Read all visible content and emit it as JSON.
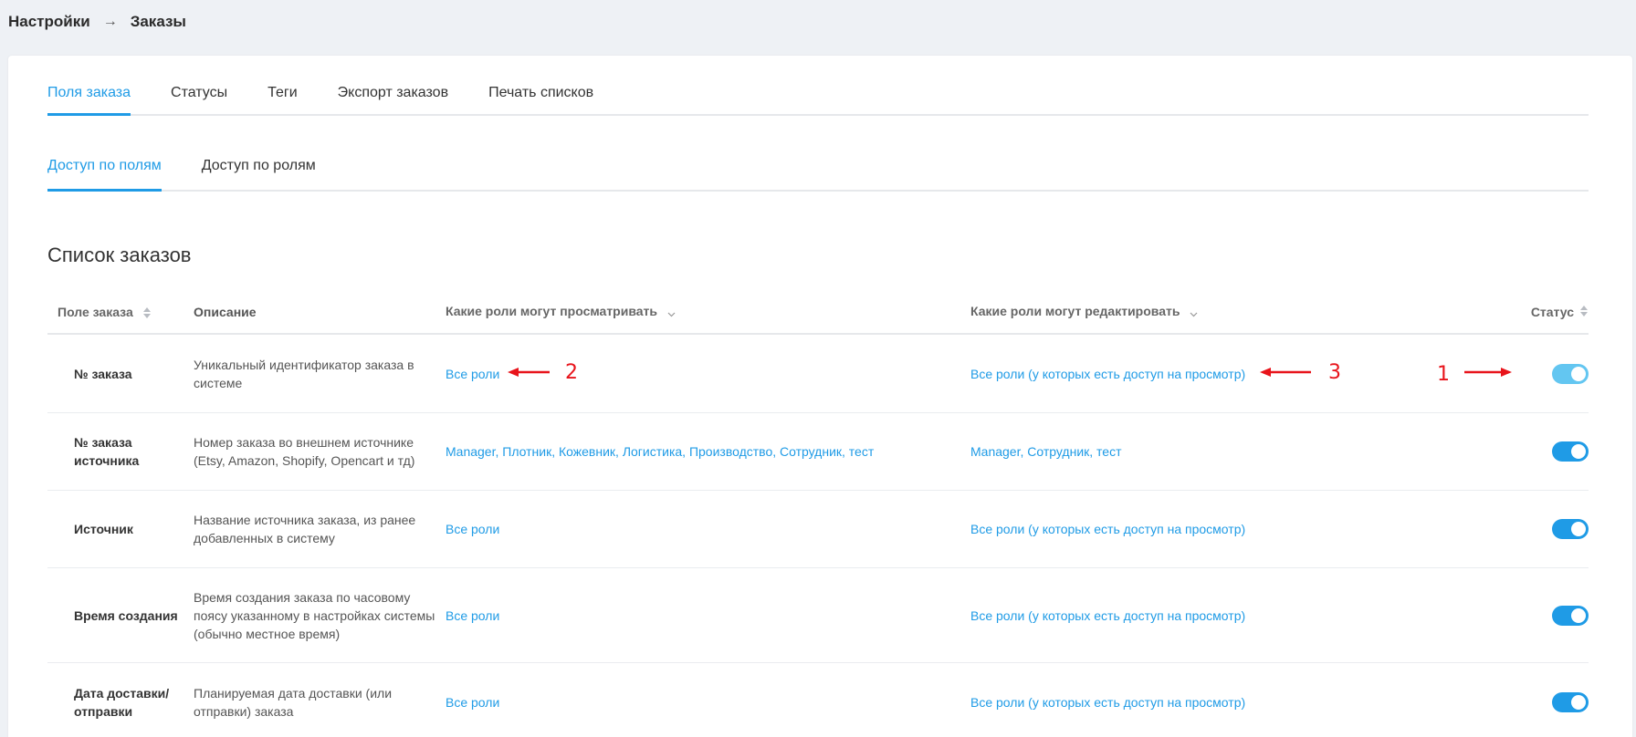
{
  "breadcrumb": {
    "items": [
      "Настройки",
      "Заказы"
    ],
    "separator": "→"
  },
  "tabs": [
    {
      "label": "Поля заказа",
      "active": true
    },
    {
      "label": "Статусы",
      "active": false
    },
    {
      "label": "Теги",
      "active": false
    },
    {
      "label": "Экспорт заказов",
      "active": false
    },
    {
      "label": "Печать списков",
      "active": false
    }
  ],
  "subtabs": [
    {
      "label": "Доступ по полям",
      "active": true
    },
    {
      "label": "Доступ по ролям",
      "active": false
    }
  ],
  "section_title": "Список заказов",
  "table": {
    "headers": {
      "field": "Поле заказа",
      "description": "Описание",
      "view_roles": "Какие роли могут просматривать",
      "edit_roles": "Какие роли могут редактировать",
      "status": "Статус"
    },
    "rows": [
      {
        "field": "№ заказа",
        "description": "Уникальный идентификатор заказа в системе",
        "view_roles": "Все роли",
        "edit_roles": "Все роли (у которых есть доступ на просмотр)",
        "enabled": true
      },
      {
        "field": "№ заказа источника",
        "description": "Номер заказа во внешнем источнике (Etsy, Amazon, Shopify, Opencart и тд)",
        "view_roles": "Manager, Плотник, Кожевник, Логистика, Производство, Сотрудник, тест",
        "edit_roles": "Manager, Сотрудник, тест",
        "enabled": true
      },
      {
        "field": "Источник",
        "description": "Название источника заказа, из ранее добавленных в систему",
        "view_roles": "Все роли",
        "edit_roles": "Все роли (у которых есть доступ на просмотр)",
        "enabled": true
      },
      {
        "field": "Время создания",
        "description": "Время создания заказа по часовому поясу указанному в настройках системы (обычно местное время)",
        "view_roles": "Все роли",
        "edit_roles": "Все роли (у которых есть доступ на просмотр)",
        "enabled": true
      },
      {
        "field": "Дата доставки/ отправки",
        "description": "Планируемая дата доставки (или отправки) заказа",
        "view_roles": "Все роли",
        "edit_roles": "Все роли (у которых есть доступ на просмотр)",
        "enabled": true
      }
    ]
  },
  "annotations": [
    "1",
    "2",
    "3"
  ],
  "colors": {
    "accent": "#1f9be6",
    "toggle_disabled_look": "#63c6f1",
    "annotation": "#e8141b",
    "page_bg": "#eef1f5"
  },
  "icons": {
    "sort": "sort-arrows-icon",
    "dropdown": "chevron-down-icon",
    "annotation_arrow": "red-arrow-icon"
  }
}
